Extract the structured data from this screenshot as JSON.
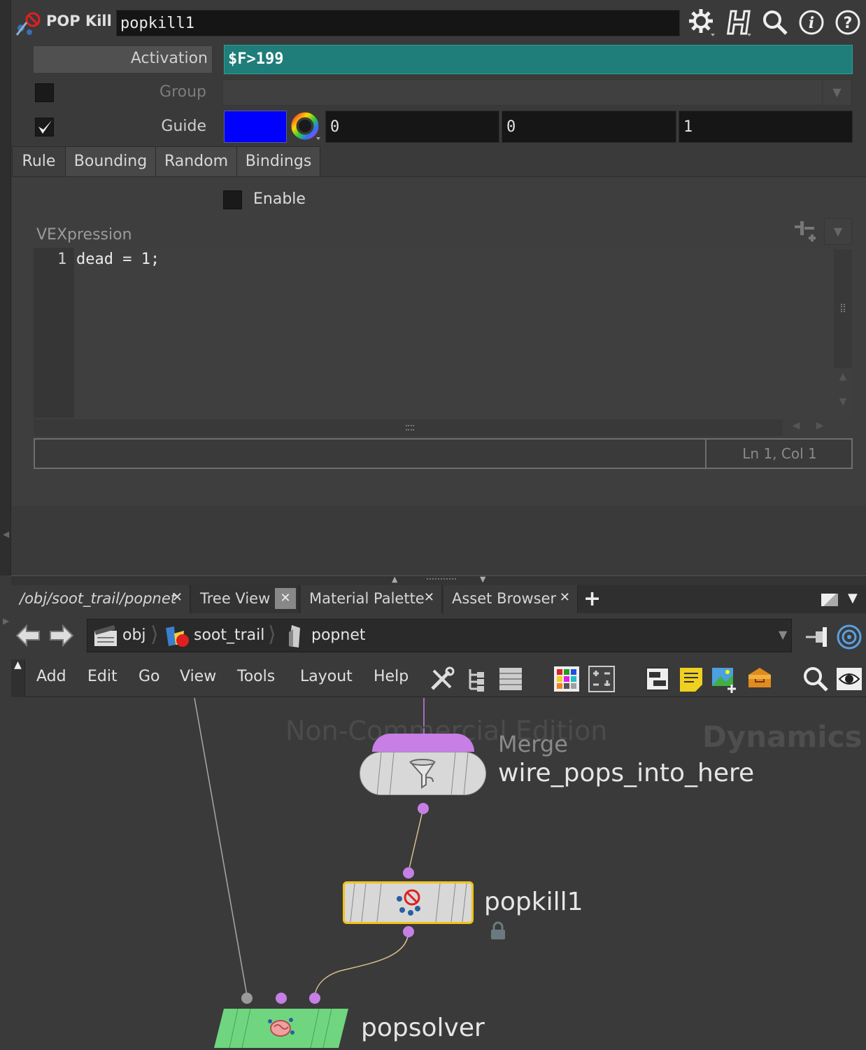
{
  "header": {
    "node_type": "POP Kill",
    "node_name": "popkill1",
    "icons": [
      "gear-icon",
      "h-menu-icon",
      "search-icon",
      "info-icon",
      "help-icon"
    ]
  },
  "params": {
    "activation": {
      "label": "Activation",
      "value": "$F>199"
    },
    "group": {
      "label": "Group",
      "value": ""
    },
    "guide": {
      "label": "Guide",
      "checked": true,
      "color": "#0000ff",
      "values": [
        "0",
        "0",
        "1"
      ]
    }
  },
  "tabs": [
    "Rule",
    "Bounding",
    "Random",
    "Bindings"
  ],
  "rule": {
    "enable_label": "Enable",
    "vex_label": "VEXpression",
    "line_number": "1",
    "code": "dead = 1;",
    "cursor_status": "Ln 1, Col 1"
  },
  "network": {
    "pane_tabs": [
      {
        "label": "/obj/soot_trail/popnet"
      },
      {
        "label": "Tree View"
      },
      {
        "label": "Material Palette"
      },
      {
        "label": "Asset Browser"
      }
    ],
    "add_tab": "+",
    "breadcrumbs": [
      "obj",
      "soot_trail",
      "popnet"
    ],
    "menu": [
      "Add",
      "Edit",
      "Go",
      "View",
      "Tools",
      "Layout",
      "Help"
    ],
    "watermark": "Non-Commercial Edition",
    "context": "Dynamics",
    "nodes": {
      "merge": {
        "type": "Merge",
        "name": "wire_pops_into_here"
      },
      "popkill": {
        "name": "popkill1"
      },
      "popsolver": {
        "name": "popsolver"
      }
    }
  },
  "colors": {
    "activation_bg": "#1f7d7a",
    "wire_dot": "#c77fe6",
    "selected_outline": "#f2c21a",
    "solver_node": "#6fd67f"
  }
}
